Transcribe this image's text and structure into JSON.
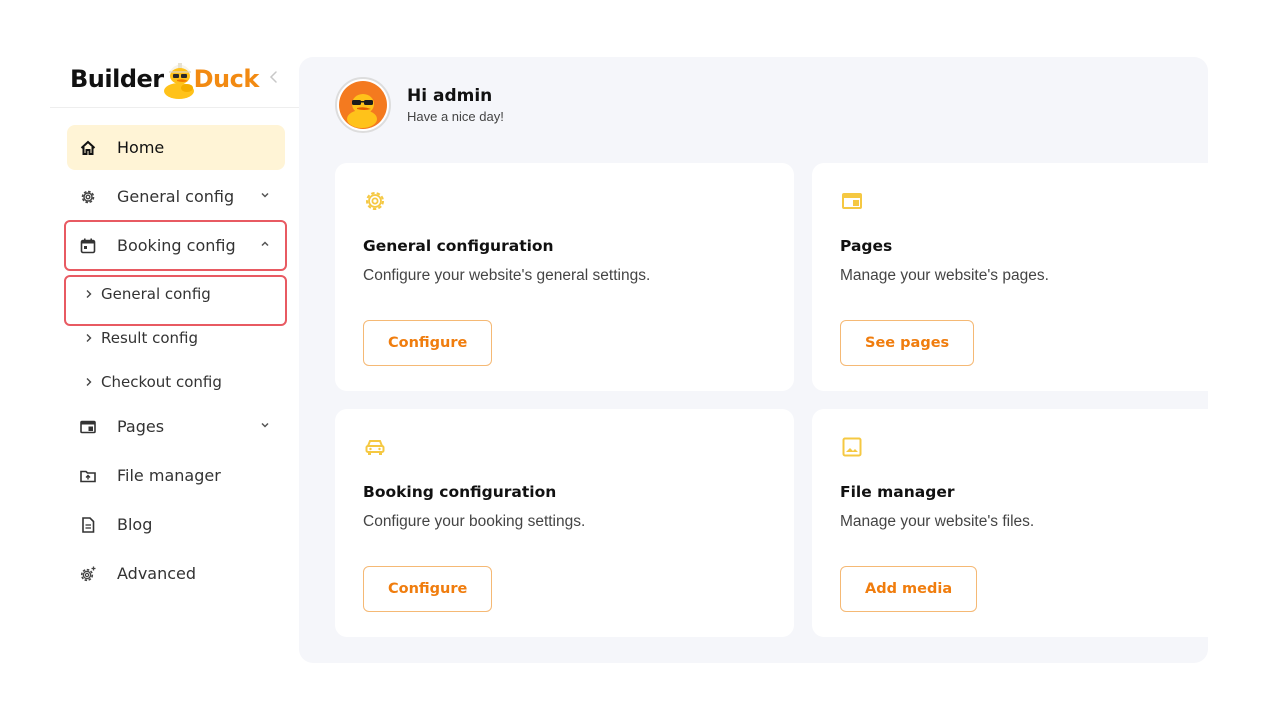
{
  "brand": {
    "part1": "Builder",
    "part2": "Duck"
  },
  "colors": {
    "accent": "#f07d0e",
    "active_bg": "#fff4d6",
    "highlight": "#e85a62",
    "main_bg": "#f5f6fa"
  },
  "sidebar": {
    "items": [
      {
        "label": "Home",
        "icon": "home-icon"
      },
      {
        "label": "General config",
        "icon": "gear-icon"
      },
      {
        "label": "Booking config",
        "icon": "calendar-icon"
      },
      {
        "label": "Pages",
        "icon": "page-layout-icon"
      },
      {
        "label": "File manager",
        "icon": "folder-icon"
      },
      {
        "label": "Blog",
        "icon": "document-icon"
      },
      {
        "label": "Advanced",
        "icon": "advanced-gear-icon"
      }
    ],
    "booking_sub": [
      {
        "label": "General config"
      },
      {
        "label": "Result config"
      },
      {
        "label": "Checkout config"
      }
    ]
  },
  "header": {
    "title": "Hi admin",
    "subtitle": "Have a nice day!"
  },
  "cards": [
    {
      "title": "General configuration",
      "description": "Configure your website's general settings.",
      "button": "Configure",
      "icon": "gear-icon"
    },
    {
      "title": "Pages",
      "description": "Manage your website's pages.",
      "button": "See pages",
      "icon": "page-layout-icon"
    },
    {
      "title": "Booking configuration",
      "description": "Configure your booking settings.",
      "button": "Configure",
      "icon": "car-icon"
    },
    {
      "title": "File manager",
      "description": "Manage your website's files.",
      "button": "Add media",
      "icon": "image-icon"
    }
  ]
}
